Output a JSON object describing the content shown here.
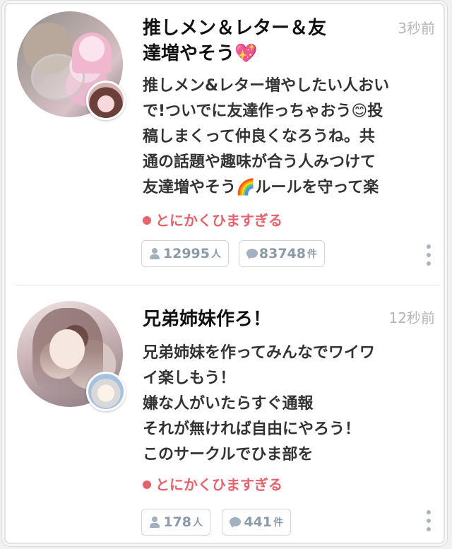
{
  "posts": [
    {
      "title_line1": "推しメン＆レター＆友",
      "title_line2": "達増やそう💖",
      "time": "3秒前",
      "description": [
        "推しメン&レター増やしたい人おい",
        "で!ついでに友達作っちゃおう😊投",
        "稿しまくって仲良くなろうね。共",
        "通の話題や趣味が合う人みつけて",
        "友達増やそう🌈ルールを守って楽"
      ],
      "tag": "とにかくひますぎる",
      "members": "12995",
      "members_unit": "人",
      "comments": "83748",
      "comments_unit": "件"
    },
    {
      "title_line1": "兄弟姉妹作ろ！",
      "title_line2": "",
      "time": "12秒前",
      "description": [
        "兄弟姉妹を作ってみんなでワイワ",
        "イ楽しもう！",
        "嫌な人がいたらすぐ通報",
        "それが無ければ自由にやろう！",
        "このサークルでひま部を"
      ],
      "tag": "とにかくひますぎる",
      "members": "178",
      "members_unit": "人",
      "comments": "441",
      "comments_unit": "件"
    }
  ],
  "colors": {
    "tag": "#e8616b",
    "stat_text": "#8a9aa9",
    "time": "#b5b5b5"
  },
  "icons": {
    "members": "person-icon",
    "comments": "speech-bubble-icon",
    "more": "more-vertical-icon"
  }
}
